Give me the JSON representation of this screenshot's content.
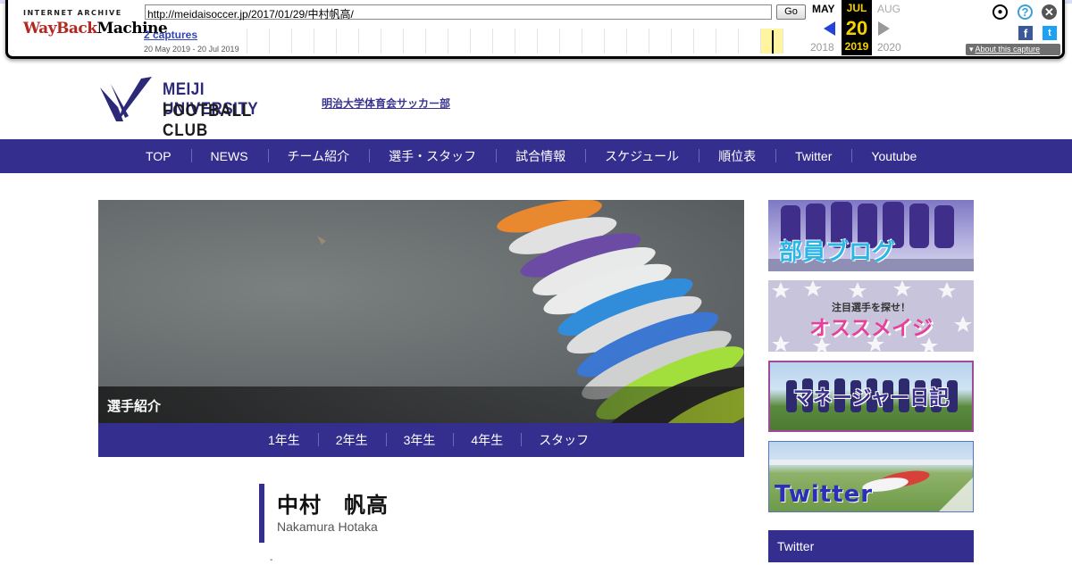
{
  "wayback": {
    "logo_top": "INTERNET ARCHIVE",
    "logo_wayback": "WayBack",
    "logo_machine": "Machine",
    "url": "http://meidaisoccer.jp/2017/01/29/中村帆高/",
    "go_label": "Go",
    "captures_label": "2 captures",
    "date_range": "20 May 2019 - 20 Jul 2019",
    "prev_month": "MAY",
    "current_month": "JUL",
    "next_month": "AUG",
    "current_day": "20",
    "prev_year": "2018",
    "current_year": "2019",
    "next_year": "2020",
    "about_label": "About this capture",
    "accent_color": "#f5d000"
  },
  "site": {
    "title_line1": "MEIJI UNIVERSITY",
    "title_line2": "FOOTBALL CLUB",
    "subtitle": "明治大学体育会サッカー部",
    "brand_color": "#342e8f"
  },
  "nav": {
    "items": [
      "TOP",
      "NEWS",
      "チーム紹介",
      "選手・スタッフ",
      "試合情報",
      "スケジュール",
      "順位表",
      "Twitter",
      "Youtube"
    ]
  },
  "hero": {
    "caption": "選手紹介"
  },
  "subnav": {
    "items": [
      "1年生",
      "2年生",
      "3年生",
      "4年生",
      "スタッフ"
    ]
  },
  "player": {
    "name": "中村　帆高",
    "name_roman": "Nakamura Hotaka",
    "tiny": "-"
  },
  "sidebar": {
    "blog_label": "部員ブログ",
    "recommend_small": "注目選手を探せ！",
    "recommend_label": "オススメイジ",
    "manager_label": "マネージャー日記",
    "twitter_banner_label": "Twitter",
    "twitter_heading": "Twitter"
  }
}
